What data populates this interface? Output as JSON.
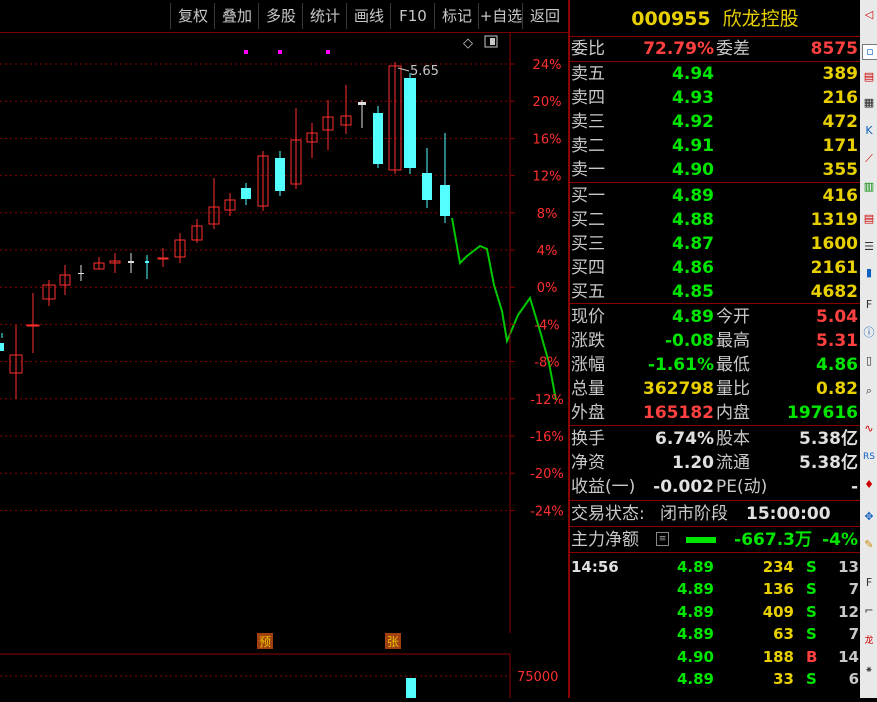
{
  "toolbar": {
    "buttons": [
      "复权",
      "叠加",
      "多股",
      "统计",
      "画线",
      "F10",
      "标记",
      "+自选",
      "返回"
    ]
  },
  "chart": {
    "max_price_label": "5.65",
    "y_ticks": [
      "24%",
      "20%",
      "16%",
      "12%",
      "8%",
      "4%",
      "0%",
      "-4%",
      "-8%",
      "-12%",
      "-16%",
      "-20%",
      "-24%"
    ],
    "marker_yu": "预",
    "marker_zhang": "张",
    "volume_tick": "75000"
  },
  "chart_data": {
    "type": "candlestick",
    "y_axis_ticks_percent": [
      24,
      20,
      16,
      12,
      8,
      4,
      0,
      -4,
      -8,
      -12,
      -16,
      -20,
      -24
    ],
    "max_price": 5.65,
    "volume_axis_tick": 75000
  },
  "quote": {
    "code": "000955",
    "name": "欣龙控股",
    "weibi_label": "委比",
    "weibi": "72.79%",
    "weicha_label": "委差",
    "weicha": "8575",
    "sells": [
      {
        "label": "卖五",
        "price": "4.94",
        "vol": "389"
      },
      {
        "label": "卖四",
        "price": "4.93",
        "vol": "216"
      },
      {
        "label": "卖三",
        "price": "4.92",
        "vol": "472"
      },
      {
        "label": "卖二",
        "price": "4.91",
        "vol": "171"
      },
      {
        "label": "卖一",
        "price": "4.90",
        "vol": "355"
      }
    ],
    "buys": [
      {
        "label": "买一",
        "price": "4.89",
        "vol": "416"
      },
      {
        "label": "买二",
        "price": "4.88",
        "vol": "1319"
      },
      {
        "label": "买三",
        "price": "4.87",
        "vol": "1600"
      },
      {
        "label": "买四",
        "price": "4.86",
        "vol": "2161"
      },
      {
        "label": "买五",
        "price": "4.85",
        "vol": "4682"
      }
    ],
    "stats": [
      {
        "l1": "现价",
        "v1": "4.89",
        "l2": "今开",
        "v2": "5.04"
      },
      {
        "l1": "涨跌",
        "v1": "-0.08",
        "l2": "最高",
        "v2": "5.31"
      },
      {
        "l1": "涨幅",
        "v1": "-1.61%",
        "l2": "最低",
        "v2": "4.86"
      },
      {
        "l1": "总量",
        "v1": "362798",
        "l2": "量比",
        "v2": "0.82"
      },
      {
        "l1": "外盘",
        "v1": "165182",
        "l2": "内盘",
        "v2": "197616"
      }
    ],
    "stats2": [
      {
        "l1": "换手",
        "v1": "6.74%",
        "l2": "股本",
        "v2": "5.38亿"
      },
      {
        "l1": "净资",
        "v1": "1.20",
        "l2": "流通",
        "v2": "5.38亿"
      },
      {
        "l1": "收益(一)",
        "v1": "-0.002",
        "l2": "PE(动)",
        "v2": "-"
      }
    ],
    "trade_status_label": "交易状态:",
    "trade_status": "闭市阶段",
    "trade_time": "15:00:00",
    "main_flow_label": "主力净额",
    "main_flow_value": "-667.3万",
    "main_flow_pct": "-4%",
    "ticks": [
      {
        "time": "14:56",
        "price": "4.89",
        "vol": "234",
        "side": "S",
        "num": "13"
      },
      {
        "time": "",
        "price": "4.89",
        "vol": "136",
        "side": "S",
        "num": "7"
      },
      {
        "time": "",
        "price": "4.89",
        "vol": "409",
        "side": "S",
        "num": "12"
      },
      {
        "time": "",
        "price": "4.89",
        "vol": "63",
        "side": "S",
        "num": "7"
      },
      {
        "time": "",
        "price": "4.90",
        "vol": "188",
        "side": "B",
        "num": "14"
      },
      {
        "time": "",
        "price": "4.89",
        "vol": "33",
        "side": "S",
        "num": "6"
      }
    ]
  },
  "colors": {
    "up": "#ff3030",
    "down": "#54ffff",
    "flow": "#00c800",
    "grid": "#8a0000"
  }
}
